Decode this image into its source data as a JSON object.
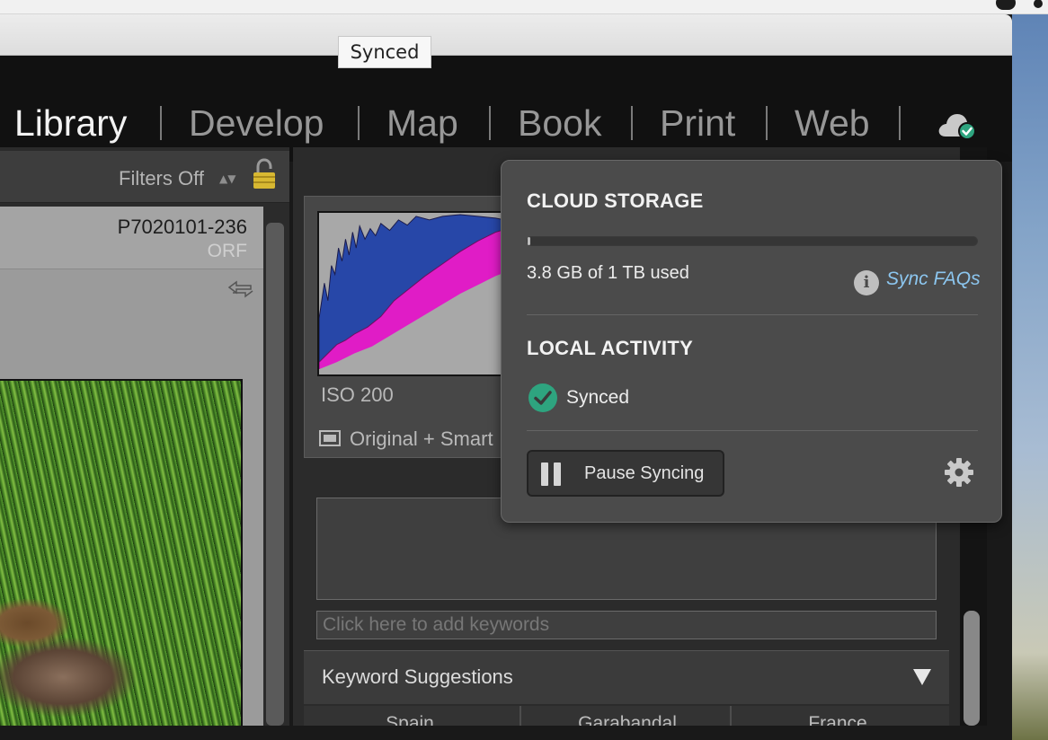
{
  "tooltip": {
    "text": "Synced"
  },
  "modules": [
    {
      "label": "Library",
      "active": true
    },
    {
      "label": "Develop",
      "active": false
    },
    {
      "label": "Map",
      "active": false
    },
    {
      "label": "Book",
      "active": false
    },
    {
      "label": "Print",
      "active": false
    },
    {
      "label": "Web",
      "active": false
    }
  ],
  "cloud_status_icon": "cloud-synced-icon",
  "grid": {
    "filter_label": "Filters Off",
    "photo": {
      "name": "P7020101-236",
      "extension": "ORF"
    }
  },
  "histogram": {
    "iso": "ISO 200",
    "view_mode": "Original + Smart"
  },
  "keywords": {
    "input_placeholder": "Click here to add keywords",
    "suggestions_title": "Keyword Suggestions",
    "suggestions": [
      "Spain",
      "Garabandal",
      "France"
    ]
  },
  "cloud_popover": {
    "storage_title": "CLOUD STORAGE",
    "usage_text": "3.8 GB of 1 TB used",
    "usage_fraction": 0.0038,
    "faq_link": "Sync FAQs",
    "activity_title": "LOCAL ACTIVITY",
    "activity_status": "Synced",
    "pause_button": "Pause Syncing"
  },
  "colors": {
    "synced_green": "#2ea47f",
    "link_blue": "#8cc6ef",
    "histogram_blue": "#2747a8",
    "histogram_magenta": "#e01cc6"
  }
}
